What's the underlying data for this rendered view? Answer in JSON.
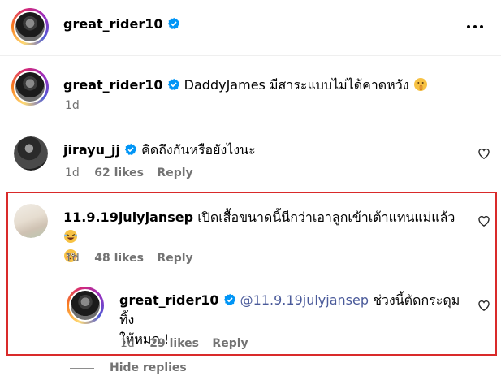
{
  "header": {
    "username": "great_rider10",
    "more_icon": "more-horizontal-icon"
  },
  "caption": {
    "username": "great_rider10",
    "text": "DaddyJames มีสาระแบบไม่ได้คาดหวัง",
    "time": "1d"
  },
  "comments": [
    {
      "username": "jirayu_jj",
      "text": "คิดถึงกันหรือยังไงนะ",
      "time": "1d",
      "likes": "62 likes",
      "reply": "Reply"
    },
    {
      "username": "11.9.19julyjansep",
      "text": "เปิดเสื้อขนาดนี้นีกว่าเอาลูกเข้าเต้าแทนแม่แล้ว",
      "time": "1d",
      "likes": "48 likes",
      "reply": "Reply"
    }
  ],
  "reply": {
    "username": "great_rider10",
    "mention": "@11.9.19julyjansep",
    "text_line1": "ช่วงนี้ตัดกระดุมทิ้ง",
    "text_line2": "ให้หมด !",
    "time": "1d",
    "likes": "29 likes",
    "reply": "Reply"
  },
  "hide_replies": "Hide replies",
  "colors": {
    "verified": "#0095f6",
    "highlight": "#d92a2a",
    "mention": "#4a5a9a",
    "meta": "#737373"
  }
}
